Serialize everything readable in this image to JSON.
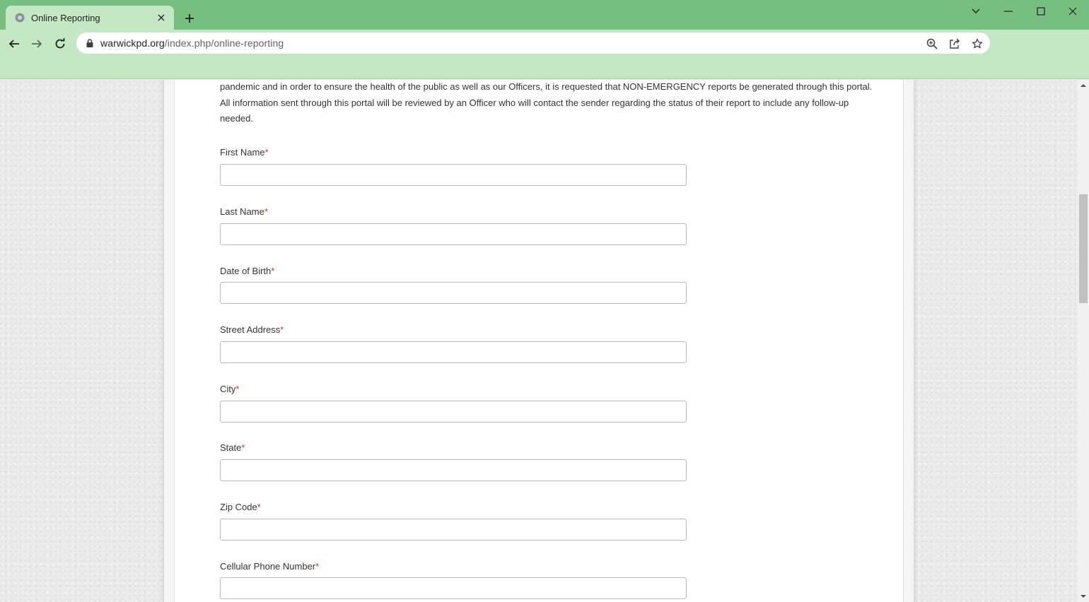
{
  "browser": {
    "tab_title": "Online Reporting",
    "url_host": "warwickpd.org",
    "url_path": "/index.php/online-reporting",
    "theme_color": "#76bf7e",
    "toolbar_color": "#c3e8c3"
  },
  "page": {
    "intro_text": "pandemic and in order to ensure the health of the public as well as our Officers, it is requested that NON-EMERGENCY reports be generated through this portal. All information sent through this portal will be reviewed by an Officer who will contact the sender regarding the status of their report to include any follow-up needed.",
    "required_marker": "*",
    "required_color": "#c0392b",
    "fields": [
      {
        "label": "First Name",
        "value": ""
      },
      {
        "label": "Last Name",
        "value": ""
      },
      {
        "label": "Date of Birth",
        "value": ""
      },
      {
        "label": "Street Address",
        "value": ""
      },
      {
        "label": "City",
        "value": ""
      },
      {
        "label": "State",
        "value": ""
      },
      {
        "label": "Zip Code",
        "value": ""
      },
      {
        "label": "Cellular Phone Number",
        "value": ""
      }
    ]
  }
}
